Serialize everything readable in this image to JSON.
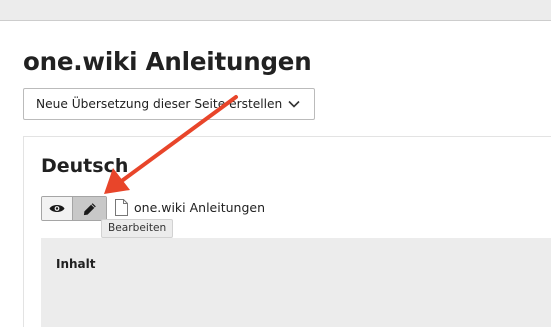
{
  "page": {
    "title": "one.wiki Anleitungen"
  },
  "translation_select": {
    "selected": "Neue Übersetzung dieser Seite erstellen",
    "icon": "chevron-down-icon"
  },
  "language_panel": {
    "heading": "Deutsch",
    "buttons": {
      "view_icon": "eye-icon",
      "edit_icon": "pencil-icon"
    },
    "page_icon": "document-icon",
    "page_name": "one.wiki Anleitungen",
    "tooltip": "Bearbeiten",
    "content_label": "Inhalt"
  },
  "annotation": {
    "arrow_color": "#e8452a"
  }
}
